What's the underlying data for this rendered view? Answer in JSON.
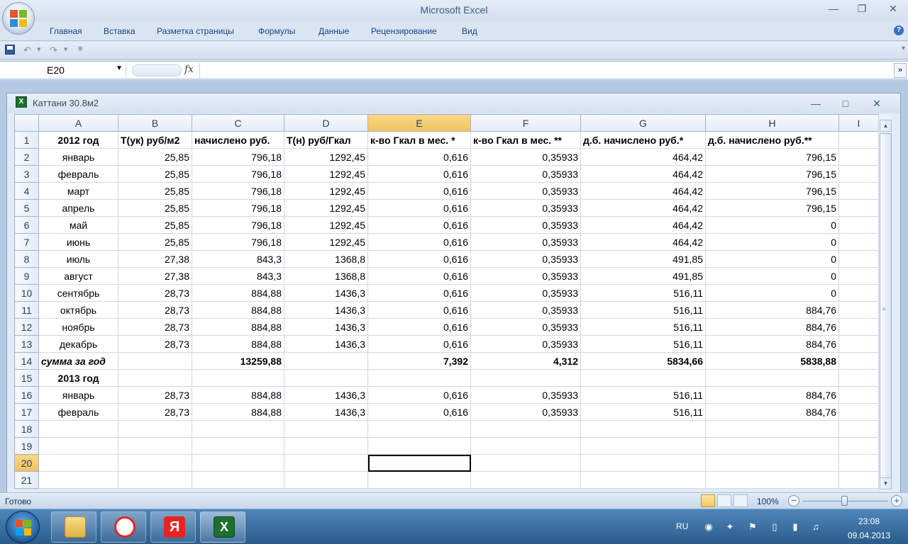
{
  "window": {
    "title": "Microsoft Excel",
    "minimize_glyph": "—",
    "restore_glyph": "❐",
    "close_glyph": "✕"
  },
  "ribbon": {
    "tabs": [
      "Главная",
      "Вставка",
      "Разметка страницы",
      "Формулы",
      "Данные",
      "Рецензирование",
      "Вид"
    ],
    "help_glyph": "?"
  },
  "qat": {
    "save_icon": "save-icon",
    "undo_glyph": "↶",
    "redo_glyph": "↷",
    "dropdown_glyph": "▾",
    "customize_glyph": "≡"
  },
  "formula_bar": {
    "name_box": "E20",
    "name_box_arrow": "▼",
    "fx_label": "fx",
    "formula_value": "",
    "expand_glyph": "»"
  },
  "workbook": {
    "title": "Каттани 30.8м2",
    "icon_letter": "X",
    "minimize_glyph": "—",
    "restore_glyph": "□",
    "close_glyph": "✕"
  },
  "sheet": {
    "columns": [
      "A",
      "B",
      "C",
      "D",
      "E",
      "F",
      "G",
      "H",
      "I"
    ],
    "selected_column": "E",
    "selected_row": "20",
    "active_cell": "E20",
    "header_row": [
      "2012 год",
      "Т(ук) руб/м2",
      "начислено руб.",
      "Т(н) руб/Гкал",
      "к-во Гкал в мес. *",
      "к-во Гкал в мес. **",
      "д.б. начислено руб.*",
      "д.б. начислено руб.**",
      ""
    ],
    "rows": [
      {
        "n": "2",
        "cells": [
          "январь",
          "25,85",
          "796,18",
          "1292,45",
          "0,616",
          "0,35933",
          "464,42",
          "796,15",
          ""
        ]
      },
      {
        "n": "3",
        "cells": [
          "февраль",
          "25,85",
          "796,18",
          "1292,45",
          "0,616",
          "0,35933",
          "464,42",
          "796,15",
          ""
        ]
      },
      {
        "n": "4",
        "cells": [
          "март",
          "25,85",
          "796,18",
          "1292,45",
          "0,616",
          "0,35933",
          "464,42",
          "796,15",
          ""
        ]
      },
      {
        "n": "5",
        "cells": [
          "апрель",
          "25,85",
          "796,18",
          "1292,45",
          "0,616",
          "0,35933",
          "464,42",
          "796,15",
          ""
        ]
      },
      {
        "n": "6",
        "cells": [
          "май",
          "25,85",
          "796,18",
          "1292,45",
          "0,616",
          "0,35933",
          "464,42",
          "0",
          ""
        ]
      },
      {
        "n": "7",
        "cells": [
          "июнь",
          "25,85",
          "796,18",
          "1292,45",
          "0,616",
          "0,35933",
          "464,42",
          "0",
          ""
        ]
      },
      {
        "n": "8",
        "cells": [
          "июль",
          "27,38",
          "843,3",
          "1368,8",
          "0,616",
          "0,35933",
          "491,85",
          "0",
          ""
        ]
      },
      {
        "n": "9",
        "cells": [
          "август",
          "27,38",
          "843,3",
          "1368,8",
          "0,616",
          "0,35933",
          "491,85",
          "0",
          ""
        ]
      },
      {
        "n": "10",
        "cells": [
          "сентябрь",
          "28,73",
          "884,88",
          "1436,3",
          "0,616",
          "0,35933",
          "516,11",
          "0",
          ""
        ]
      },
      {
        "n": "11",
        "cells": [
          "октябрь",
          "28,73",
          "884,88",
          "1436,3",
          "0,616",
          "0,35933",
          "516,11",
          "884,76",
          ""
        ]
      },
      {
        "n": "12",
        "cells": [
          "ноябрь",
          "28,73",
          "884,88",
          "1436,3",
          "0,616",
          "0,35933",
          "516,11",
          "884,76",
          ""
        ]
      },
      {
        "n": "13",
        "cells": [
          "декабрь",
          "28,73",
          "884,88",
          "1436,3",
          "0,616",
          "0,35933",
          "516,11",
          "884,76",
          ""
        ]
      },
      {
        "n": "14",
        "cells": [
          "сумма за год",
          "",
          "13259,88",
          "",
          "7,392",
          "4,312",
          "5834,66",
          "5838,88",
          ""
        ]
      },
      {
        "n": "15",
        "cells": [
          "2013 год",
          "",
          "",
          "",
          "",
          "",
          "",
          "",
          ""
        ]
      },
      {
        "n": "16",
        "cells": [
          "январь",
          "28,73",
          "884,88",
          "1436,3",
          "0,616",
          "0,35933",
          "516,11",
          "884,76",
          ""
        ]
      },
      {
        "n": "17",
        "cells": [
          "февраль",
          "28,73",
          "884,88",
          "1436,3",
          "0,616",
          "0,35933",
          "516,11",
          "884,76",
          ""
        ]
      },
      {
        "n": "18",
        "cells": [
          "",
          "",
          "",
          "",
          "",
          "",
          "",
          "",
          ""
        ]
      },
      {
        "n": "19",
        "cells": [
          "",
          "",
          "",
          "",
          "",
          "",
          "",
          "",
          ""
        ]
      },
      {
        "n": "20",
        "cells": [
          "",
          "",
          "",
          "",
          "",
          "",
          "",
          "",
          ""
        ]
      },
      {
        "n": "21",
        "cells": [
          "",
          "",
          "",
          "",
          "",
          "",
          "",
          "",
          ""
        ]
      }
    ]
  },
  "statusbar": {
    "status": "Готово",
    "zoom": "100%",
    "zoom_minus": "−",
    "zoom_plus": "+",
    "view_buttons": [
      "normal-view-icon",
      "page-layout-icon",
      "page-break-icon"
    ]
  },
  "taskbar": {
    "apps": [
      "explorer-icon",
      "yandex-browser-icon",
      "yandex-icon",
      "excel-icon"
    ],
    "language": "RU",
    "time": "23:08",
    "date": "09.04.2013"
  },
  "colors": {
    "accent": "#15428b",
    "selected_header": "#f1c15f",
    "grid_line": "#d0d7e5"
  }
}
